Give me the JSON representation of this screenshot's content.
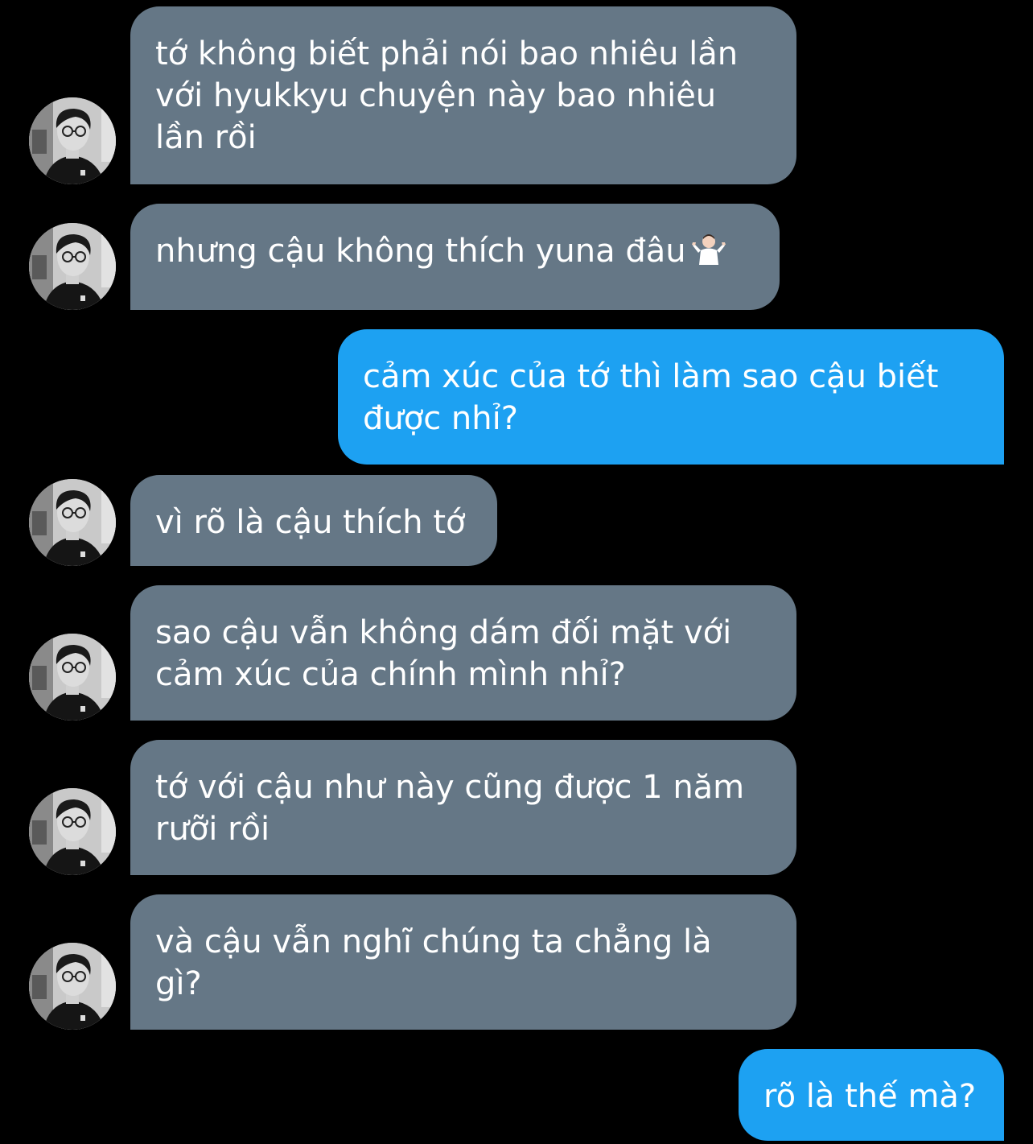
{
  "conversation": {
    "colors": {
      "background": "#000000",
      "incoming_bubble": "#657786",
      "outgoing_bubble": "#1da1f2",
      "text": "#ffffff"
    },
    "avatar_icon": "person-with-glasses-photo",
    "messages": [
      {
        "sender": "them",
        "lines": [
          "tớ không biết phải nói bao nhiêu lần",
          "với hyukkyu chuyện này bao nhiêu",
          "lần rồi"
        ]
      },
      {
        "sender": "them",
        "lines": [
          "nhưng cậu không thích yuna đâu"
        ],
        "emoji": "person-shrugging-icon"
      },
      {
        "sender": "me",
        "lines": [
          "cảm xúc của tớ thì làm sao cậu biết",
          "được nhỉ?"
        ]
      },
      {
        "sender": "them",
        "lines": [
          "vì rõ là cậu thích tớ"
        ]
      },
      {
        "sender": "them",
        "lines": [
          "sao cậu vẫn không dám đối mặt với",
          "cảm xúc của chính mình nhỉ?"
        ]
      },
      {
        "sender": "them",
        "lines": [
          "tớ với cậu như này cũng được 1 năm",
          "rưỡi rồi"
        ]
      },
      {
        "sender": "them",
        "lines": [
          "và cậu vẫn nghĩ chúng ta chẳng là",
          "gì?"
        ]
      },
      {
        "sender": "me",
        "lines": [
          "rõ là thế mà?"
        ]
      }
    ]
  }
}
